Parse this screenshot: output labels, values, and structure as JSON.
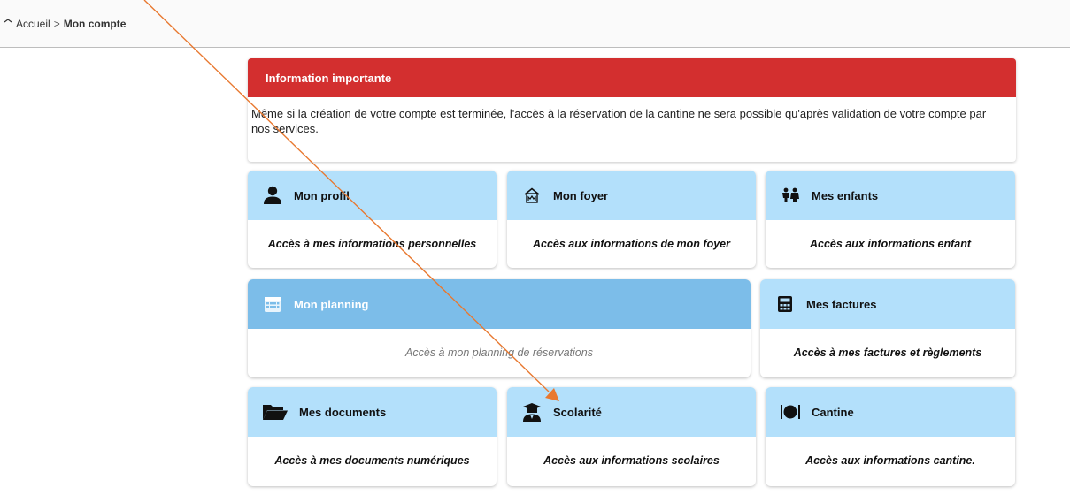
{
  "breadcrumb": {
    "home": "Accueil",
    "separator": ">",
    "current": "Mon compte"
  },
  "info": {
    "title": "Information importante",
    "text": "Même si la création de votre compte est terminée, l'accès à la réservation de la cantine ne sera possible qu'après validation de votre compte par nos services."
  },
  "cards": {
    "profil": {
      "title": "Mon profil",
      "desc": "Accès à mes informations personnelles",
      "icon": "user-icon"
    },
    "foyer": {
      "title": "Mon foyer",
      "desc": "Accès aux informations de mon foyer",
      "icon": "home-icon"
    },
    "enfants": {
      "title": "Mes enfants",
      "desc": "Accès aux informations enfant",
      "icon": "children-icon"
    },
    "planning": {
      "title": "Mon planning",
      "desc": "Accès à mon planning de réservations",
      "icon": "calendar-icon"
    },
    "factures": {
      "title": "Mes factures",
      "desc": "Accès à mes factures et règlements",
      "icon": "calculator-icon"
    },
    "documents": {
      "title": "Mes documents",
      "desc": "Accès à mes documents numériques",
      "icon": "folder-icon"
    },
    "scolarite": {
      "title": "Scolarité",
      "desc": "Accès aux informations scolaires",
      "icon": "graduate-icon"
    },
    "cantine": {
      "title": "Cantine",
      "desc": "Accès aux informations cantine.",
      "icon": "plate-icon"
    }
  },
  "colors": {
    "alert": "#d32f2f",
    "card_header": "#b3e0fb",
    "card_header_active": "#7cbde9",
    "annotation_arrow": "#e8782f"
  }
}
